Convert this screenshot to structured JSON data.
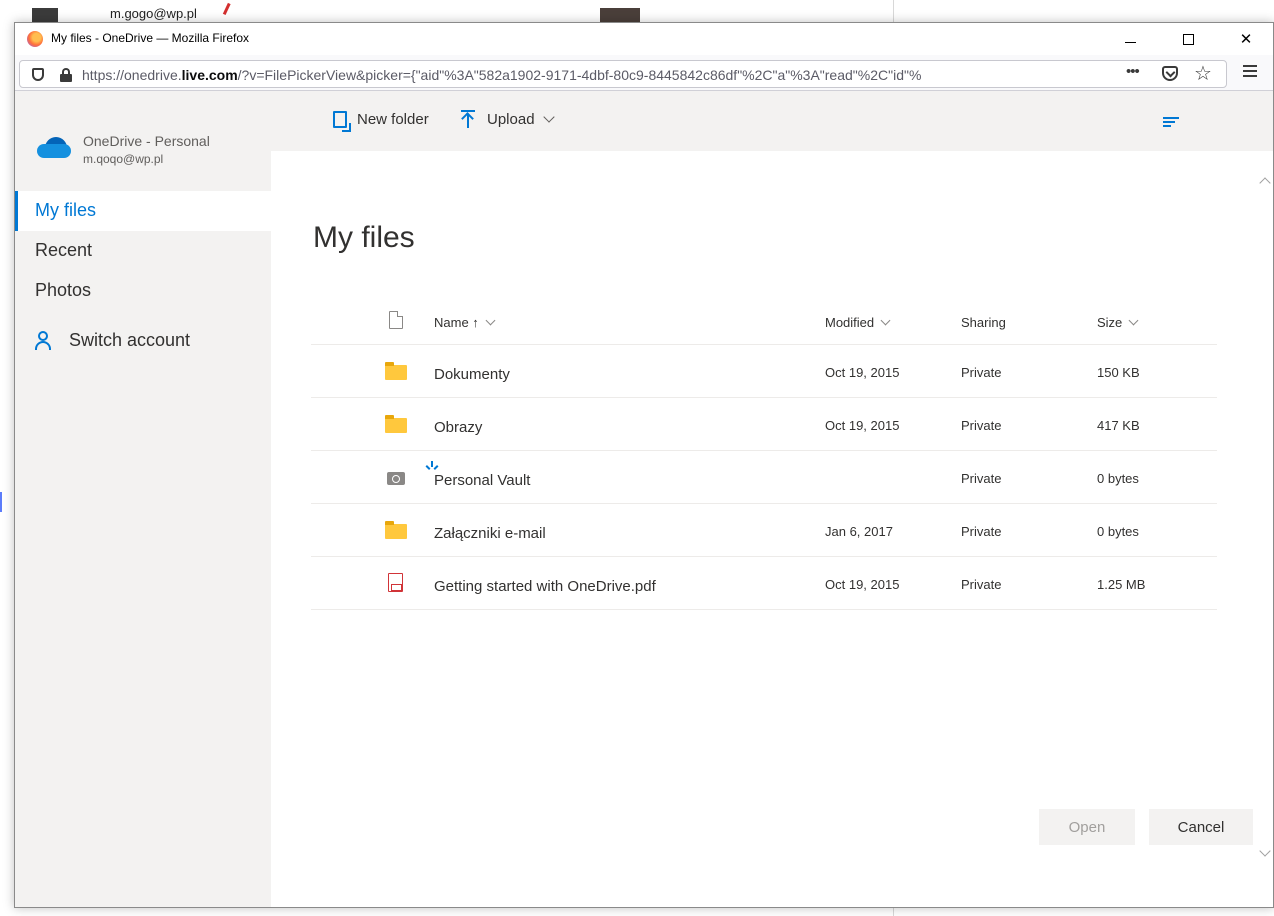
{
  "background": {
    "email_text": "m.gogo@wp.pl"
  },
  "browser": {
    "window_title": "My files - OneDrive — Mozilla Firefox",
    "url_prefix": "https://onedrive.",
    "url_domain": "live.com",
    "url_rest": "/?v=FilePickerView&picker={\"aid\"%3A\"582a1902-9171-4dbf-80c9-8445842c86df\"%2C\"a\"%3A\"read\"%2C\"id\"%",
    "url_more": "•••",
    "icons": [
      "firefox-logo",
      "shield-icon",
      "lock-icon",
      "pocket-icon",
      "star-icon",
      "menu-icon"
    ]
  },
  "sidebar": {
    "account_name": "OneDrive - Personal",
    "account_email": "m.qoqo@wp.pl",
    "items": [
      {
        "label": "My files",
        "selected": true
      },
      {
        "label": "Recent",
        "selected": false
      },
      {
        "label": "Photos",
        "selected": false
      }
    ],
    "switch_account": "Switch account"
  },
  "commands": {
    "new_folder": "New folder",
    "upload": "Upload"
  },
  "main": {
    "title": "My files",
    "columns": {
      "name": "Name ↑",
      "modified": "Modified",
      "sharing": "Sharing",
      "size": "Size"
    },
    "files": [
      {
        "name": "Dokumenty",
        "modified": "Oct 19, 2015",
        "sharing": "Private",
        "size": "150 KB",
        "icon": "folder-icon"
      },
      {
        "name": "Obrazy",
        "modified": "Oct 19, 2015",
        "sharing": "Private",
        "size": "417 KB",
        "icon": "folder-icon"
      },
      {
        "name": "Personal Vault",
        "modified": "",
        "sharing": "Private",
        "size": "0 bytes",
        "icon": "vault-icon"
      },
      {
        "name": "Załączniki e-mail",
        "modified": "Jan 6, 2017",
        "sharing": "Private",
        "size": "0 bytes",
        "icon": "folder-icon"
      },
      {
        "name": "Getting started with OneDrive.pdf",
        "modified": "Oct 19, 2015",
        "sharing": "Private",
        "size": "1.25 MB",
        "icon": "pdf-icon"
      }
    ]
  },
  "footer": {
    "open": "Open",
    "cancel": "Cancel"
  },
  "colors": {
    "accent": "#0078d4",
    "folder": "#ffc83d",
    "sidebar_bg": "#f3f2f1"
  }
}
